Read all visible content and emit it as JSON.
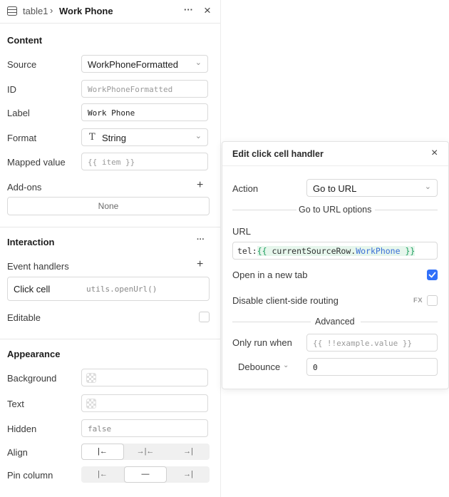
{
  "header": {
    "breadcrumb_parent": "table1",
    "breadcrumb_sep": "›",
    "title": "Work Phone",
    "more_glyph": "···",
    "close_glyph": "×"
  },
  "content": {
    "title": "Content",
    "source": {
      "label": "Source",
      "value": "WorkPhoneFormatted"
    },
    "id": {
      "label": "ID",
      "placeholder": "WorkPhoneFormatted"
    },
    "label": {
      "label": "Label",
      "value": "Work Phone"
    },
    "format": {
      "label": "Format",
      "icon_glyph": "T",
      "value": "String"
    },
    "mapped_value": {
      "label": "Mapped value",
      "placeholder": "{{ item }}"
    },
    "addons": {
      "label": "Add-ons",
      "add_glyph": "+",
      "value": "None"
    }
  },
  "interaction": {
    "title": "Interaction",
    "more_glyph": "···",
    "event_handlers": {
      "label": "Event handlers",
      "add_glyph": "+"
    },
    "handler": {
      "event": "Click cell",
      "action": "utils.openUrl()"
    },
    "editable": {
      "label": "Editable",
      "checked": false
    }
  },
  "appearance": {
    "title": "Appearance",
    "background": {
      "label": "Background"
    },
    "text": {
      "label": "Text"
    },
    "hidden": {
      "label": "Hidden",
      "placeholder": "false"
    },
    "align": {
      "label": "Align",
      "options": [
        "|←",
        "→|←",
        "→|"
      ],
      "selected": 0
    },
    "pin": {
      "label": "Pin column",
      "options": [
        "|←",
        "—",
        "→|"
      ],
      "selected": 1
    }
  },
  "popup": {
    "title": "Edit click cell handler",
    "close_glyph": "×",
    "action": {
      "label": "Action",
      "value": "Go to URL"
    },
    "options_heading": "Go to URL options",
    "url": {
      "label": "URL",
      "prefix": "tel:",
      "open": "{{ ",
      "obj": "currentSourceRow",
      "dot": ".",
      "prop": "WorkPhone",
      "close": " }}"
    },
    "new_tab": {
      "label": "Open in a new tab",
      "checked": true
    },
    "disable_routing": {
      "label": "Disable client-side routing",
      "fx": "FX",
      "checked": false
    },
    "advanced_heading": "Advanced",
    "only_run_when": {
      "label": "Only run when",
      "placeholder": "{{ !!example.value }}"
    },
    "debounce": {
      "label": "Debounce",
      "value": "0"
    }
  },
  "colors": {
    "accent": "#3170f9",
    "code_green": "#1a9e5c",
    "code_blue": "#3b6fd8"
  }
}
